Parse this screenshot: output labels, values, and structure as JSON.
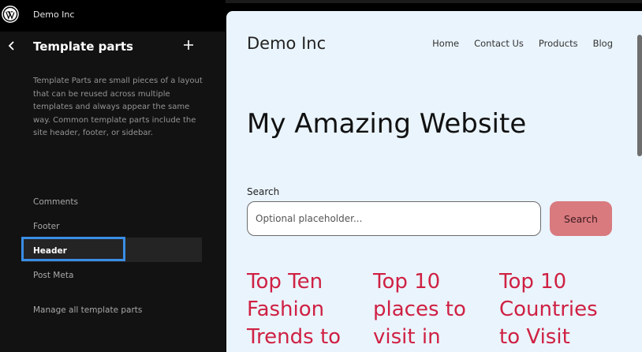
{
  "topbar": {
    "site_name": "Demo Inc"
  },
  "sidebar": {
    "title": "Template parts",
    "description": "Template Parts are small pieces of a layout that can be reused across multiple templates and always appear the same way. Common template parts include the site header, footer, or sidebar.",
    "items": [
      {
        "label": "Comments",
        "active": false
      },
      {
        "label": "Footer",
        "active": false
      },
      {
        "label": "Header",
        "active": true
      },
      {
        "label": "Post Meta",
        "active": false
      }
    ],
    "manage_link": "Manage all template parts"
  },
  "canvas": {
    "brand": "Demo Inc",
    "nav": [
      "Home",
      "Contact Us",
      "Products",
      "Blog"
    ],
    "hero": "My Amazing Website",
    "search": {
      "label": "Search",
      "placeholder": "Optional placeholder...",
      "value": "",
      "button": "Search"
    },
    "posts": [
      {
        "title": "Top Ten Fashion Trends to"
      },
      {
        "title": "Top 10 places to visit in"
      },
      {
        "title": "Top 10 Countries to Visit"
      }
    ]
  },
  "colors": {
    "sidebar_bg": "#121212",
    "canvas_bg": "#eaf4fd",
    "accent_focus": "#3a8ee6",
    "post_title": "#cf2143",
    "search_button": "#d97a7f"
  }
}
